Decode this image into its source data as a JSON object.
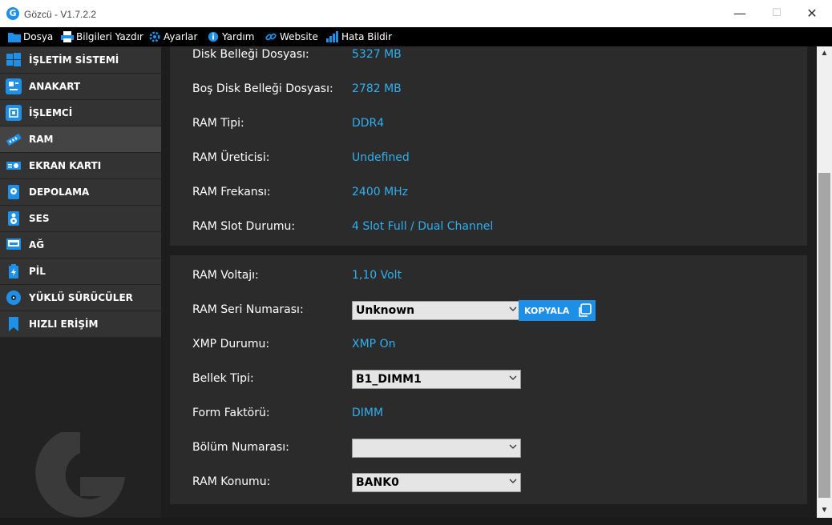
{
  "window": {
    "title": "Gözcü - V1.7.2.2",
    "minimize": "—",
    "maximize": "☐",
    "close": "✕"
  },
  "menu": [
    {
      "label": "Dosya",
      "icon": "folder-icon"
    },
    {
      "label": "Bilgileri Yazdır",
      "icon": "print-icon"
    },
    {
      "label": "Ayarlar",
      "icon": "gear-icon"
    },
    {
      "label": "Yardım",
      "icon": "info-icon"
    },
    {
      "label": "Website",
      "icon": "link-icon"
    },
    {
      "label": "Hata Bildir",
      "icon": "bars-icon"
    }
  ],
  "sidebar": {
    "active": "RAM",
    "items": [
      {
        "label": "İŞLETİM SİSTEMİ",
        "icon": "windows-icon",
        "color": "#1e90e8"
      },
      {
        "label": "ANAKART",
        "icon": "motherboard-icon",
        "color": "#1e90e8"
      },
      {
        "label": "İŞLEMCİ",
        "icon": "cpu-icon",
        "color": "#1e90e8"
      },
      {
        "label": "RAM",
        "icon": "ram-icon",
        "color": "#1e90e8"
      },
      {
        "label": "EKRAN KARTI",
        "icon": "gpu-icon",
        "color": "#1e90e8"
      },
      {
        "label": "DEPOLAMA",
        "icon": "storage-icon",
        "color": "#1e90e8"
      },
      {
        "label": "SES",
        "icon": "speaker-icon",
        "color": "#1e90e8"
      },
      {
        "label": "AĞ",
        "icon": "network-icon",
        "color": "#1e90e8"
      },
      {
        "label": "PİL",
        "icon": "battery-icon",
        "color": "#1e90e8"
      },
      {
        "label": "YÜKLÜ SÜRÜCÜLER",
        "icon": "disc-icon",
        "color": "#1e90e8"
      },
      {
        "label": "HIZLI ERİŞİM",
        "icon": "bookmark-icon",
        "color": "#1e90e8"
      }
    ]
  },
  "panel1": {
    "rows": [
      {
        "label": "Disk Belleği Dosyası:",
        "value": "5327 MB"
      },
      {
        "label": "Boş Disk Belleği Dosyası:",
        "value": "2782 MB"
      },
      {
        "label": "RAM Tipi:",
        "value": "DDR4"
      },
      {
        "label": "RAM Üreticisi:",
        "value": "Undefined"
      },
      {
        "label": "RAM Frekansı:",
        "value": "2400 MHz"
      },
      {
        "label": "RAM Slot Durumu:",
        "value": "4 Slot Full / Dual Channel"
      }
    ]
  },
  "panel2": {
    "voltage": {
      "label": "RAM Voltajı:",
      "value": "1,10 Volt"
    },
    "serial": {
      "label": "RAM Seri Numarası:",
      "value": "Unknown",
      "copy_label": "KOPYALA"
    },
    "xmp": {
      "label": "XMP Durumu:",
      "value": "XMP On"
    },
    "bank": {
      "label": "Bellek Tipi:",
      "value": "B1_DIMM1"
    },
    "form": {
      "label": "Form Faktörü:",
      "value": "DIMM"
    },
    "part": {
      "label": "Bölüm Numarası:",
      "value": ""
    },
    "location": {
      "label": "RAM Konumu:",
      "value": "BANK0"
    }
  },
  "colors": {
    "accent": "#1e90e8",
    "value_text": "#2eb0f0",
    "panel_bg": "#2b2b2b",
    "sidebar_item_bg": "#333333"
  }
}
